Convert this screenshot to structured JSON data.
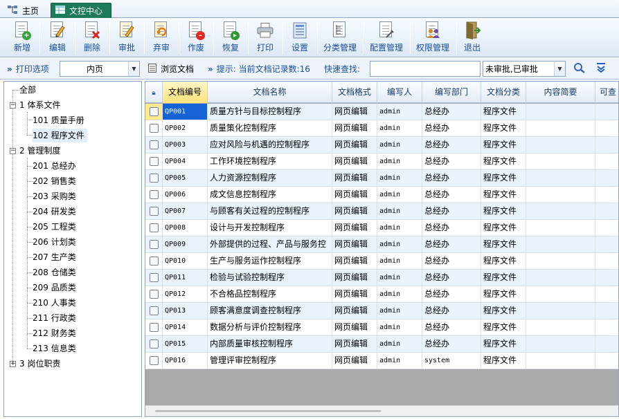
{
  "tabs": {
    "home_label": "主页",
    "active_label": "文控中心"
  },
  "toolbar": {
    "buttons": [
      {
        "label": "新增",
        "icon": "add-doc-icon"
      },
      {
        "label": "编辑",
        "icon": "edit-icon"
      },
      {
        "label": "删除",
        "icon": "delete-icon"
      },
      {
        "label": "审批",
        "icon": "approve-icon"
      },
      {
        "label": "弃审",
        "icon": "unapprove-icon"
      },
      {
        "label": "作废",
        "icon": "void-icon"
      },
      {
        "label": "恢复",
        "icon": "restore-icon"
      },
      {
        "label": "打印",
        "icon": "printer-icon"
      },
      {
        "label": "设置",
        "icon": "settings-icon"
      },
      {
        "label": "分类管理",
        "icon": "category-icon"
      },
      {
        "label": "配置管理",
        "icon": "config-icon"
      },
      {
        "label": "权限管理",
        "icon": "users-icon"
      },
      {
        "label": "退出",
        "icon": "exit-icon"
      }
    ]
  },
  "options": {
    "print_options_label": "打印选项",
    "print_scope_value": "内页",
    "browse_label": "浏览文档",
    "hint_label": "提示: 当前文档记录数:16",
    "quick_search_label": "快速查找:",
    "quick_search_value": "",
    "status_filter_value": "未审批,已审批"
  },
  "tree": {
    "root": "全部",
    "nodes": [
      {
        "label": "1 体系文件"
      },
      {
        "label": "101 质量手册"
      },
      {
        "label": "102 程序文件"
      },
      {
        "label": "2 管理制度"
      },
      {
        "label": "201 总经办"
      },
      {
        "label": "202 销售类"
      },
      {
        "label": "203 采购类"
      },
      {
        "label": "204 研发类"
      },
      {
        "label": "205 工程类"
      },
      {
        "label": "206 计划类"
      },
      {
        "label": "207 生产类"
      },
      {
        "label": "208 仓储类"
      },
      {
        "label": "209 品质类"
      },
      {
        "label": "210 人事类"
      },
      {
        "label": "211 行政类"
      },
      {
        "label": "212 财务类"
      },
      {
        "label": "213 信息类"
      },
      {
        "label": "3 岗位职责"
      }
    ]
  },
  "grid": {
    "columns": [
      "文档编号",
      "文档名称",
      "文档格式",
      "编写人",
      "编写部门",
      "文档分类",
      "内容简要",
      "可查"
    ],
    "rows": [
      [
        "QP001",
        "质量方针与目标控制程序",
        "网页编辑",
        "admin",
        "总经办",
        "程序文件",
        ""
      ],
      [
        "QP002",
        "质量策化控制程序",
        "网页编辑",
        "admin",
        "总经办",
        "程序文件",
        ""
      ],
      [
        "QP003",
        "应对风险与机遇的控制程序",
        "网页编辑",
        "admin",
        "总经办",
        "程序文件",
        ""
      ],
      [
        "QP004",
        "工作环境控制程序",
        "网页编辑",
        "admin",
        "总经办",
        "程序文件",
        ""
      ],
      [
        "QP005",
        "人力资源控制程序",
        "网页编辑",
        "admin",
        "总经办",
        "程序文件",
        ""
      ],
      [
        "QP006",
        "成文信息控制程序",
        "网页编辑",
        "admin",
        "总经办",
        "程序文件",
        ""
      ],
      [
        "QP007",
        "与顾客有关过程的控制程序",
        "网页编辑",
        "admin",
        "总经办",
        "程序文件",
        ""
      ],
      [
        "QP008",
        "设计与开发控制程序",
        "网页编辑",
        "admin",
        "总经办",
        "程序文件",
        ""
      ],
      [
        "QP009",
        "外部提供的过程、产品与服务控",
        "网页编辑",
        "admin",
        "总经办",
        "程序文件",
        ""
      ],
      [
        "QP010",
        "生产与服务运作控制程序",
        "网页编辑",
        "admin",
        "总经办",
        "程序文件",
        ""
      ],
      [
        "QP011",
        "检验与试验控制程序",
        "网页编辑",
        "admin",
        "总经办",
        "程序文件",
        ""
      ],
      [
        "QP012",
        "不合格品控制程序",
        "网页编辑",
        "admin",
        "总经办",
        "程序文件",
        ""
      ],
      [
        "QP013",
        "顾客满意度调查控制程序",
        "网页编辑",
        "admin",
        "总经办",
        "程序文件",
        ""
      ],
      [
        "QP014",
        "数据分析与评价控制程序",
        "网页编辑",
        "admin",
        "总经办",
        "程序文件",
        ""
      ],
      [
        "QP015",
        "内部质量审核控制程序",
        "网页编辑",
        "admin",
        "总经办",
        "程序文件",
        ""
      ],
      [
        "QP016",
        "管理评审控制程序",
        "网页编辑",
        "admin",
        "system",
        "程序文件",
        ""
      ]
    ]
  },
  "colors": {
    "active_tab": "#1d7a5b",
    "selected_cell": "#1663d8",
    "sorted_header": "#ffe27a",
    "alt_row": "#eaf2fb"
  }
}
